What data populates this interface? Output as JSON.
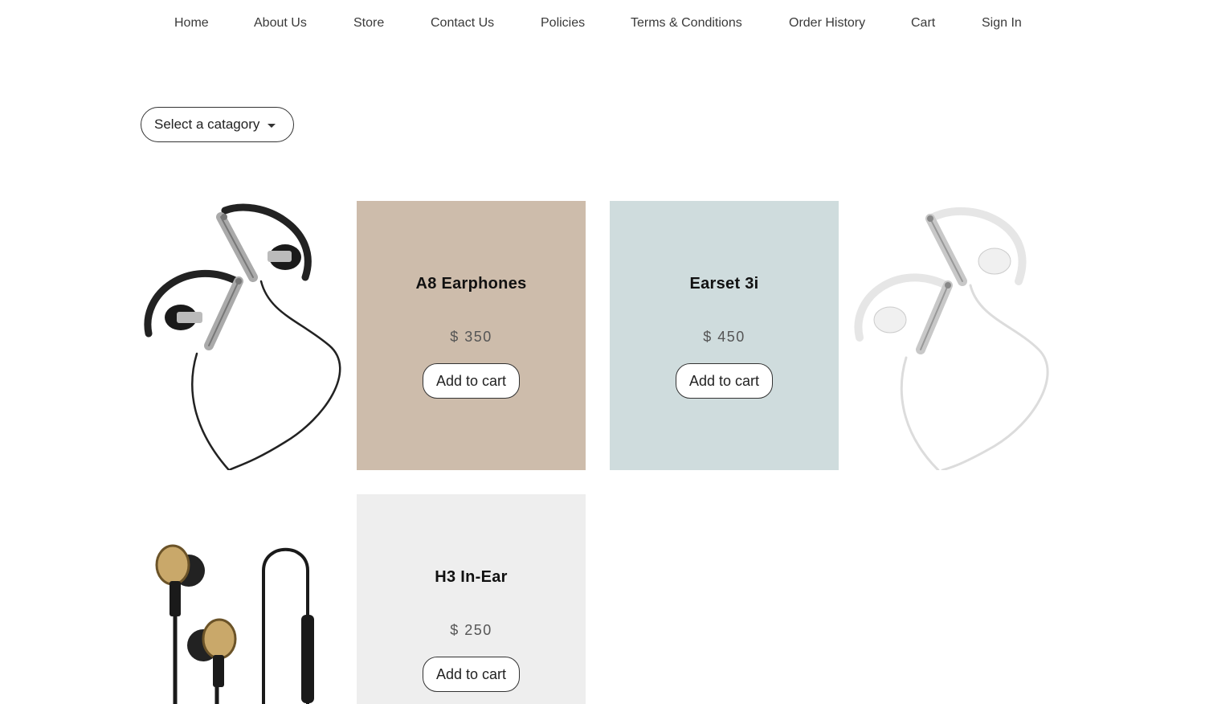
{
  "nav": {
    "items": [
      {
        "label": "Home"
      },
      {
        "label": "About Us"
      },
      {
        "label": "Store"
      },
      {
        "label": "Contact Us"
      },
      {
        "label": "Policies"
      },
      {
        "label": "Terms & Conditions"
      },
      {
        "label": "Order History"
      },
      {
        "label": "Cart"
      },
      {
        "label": "Sign In"
      }
    ]
  },
  "filter": {
    "category_label": "Select a catagory"
  },
  "products": [
    {
      "name": "A8 Earphones",
      "price": "$ 350",
      "button": "Add to cart",
      "color": "#cdbcab"
    },
    {
      "name": "Earset 3i",
      "price": "$ 450",
      "button": "Add to cart",
      "color": "#cfdcdd"
    },
    {
      "name": "H3 In-Ear",
      "price": "$ 250",
      "button": "Add to cart",
      "color": "#eeeeee"
    }
  ]
}
